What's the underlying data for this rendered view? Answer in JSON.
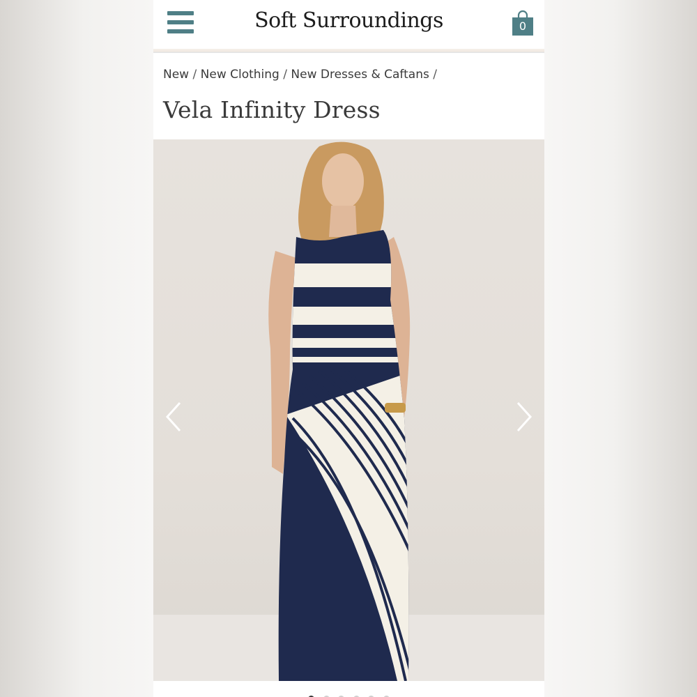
{
  "header": {
    "brand": "Soft Surroundings",
    "menu_icon": "hamburger-menu-icon",
    "cart_icon": "shopping-bag-icon",
    "cart_count": "0",
    "accent_color": "#4f7f86"
  },
  "breadcrumb": {
    "items": [
      "New",
      "New Clothing",
      "New Dresses & Caftans"
    ],
    "separator": "/"
  },
  "product": {
    "title": "Vela Infinity Dress"
  },
  "gallery": {
    "prev_icon": "chevron-left-icon",
    "next_icon": "chevron-right-icon",
    "slide_count": 6,
    "active_index": 0
  }
}
